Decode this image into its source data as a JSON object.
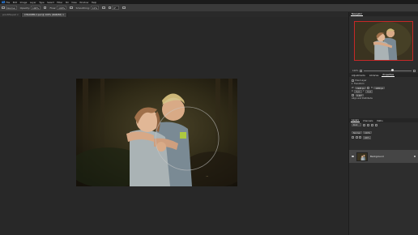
{
  "menubar": {
    "app_logo": "Ps",
    "items": [
      "File",
      "Edit",
      "Image",
      "Layer",
      "Type",
      "Select",
      "Filter",
      "3D",
      "View",
      "Window",
      "Help"
    ]
  },
  "optionsbar": {
    "tool_preset": "Normal",
    "opacity_label": "Opacity:",
    "opacity_value": "100%",
    "flow_label": "Flow:",
    "flow_value": "100%",
    "smoothing_label": "Smoothing:",
    "smoothing_value": "10%",
    "angle_value": "0°"
  },
  "tabs": [
    {
      "label": "proof-file.psd ×",
      "active": false
    },
    {
      "label": "CHILDREN-2.psd @ 100% (RGB/8#) ×",
      "active": true
    }
  ],
  "navigator": {
    "tabs": [
      "Navigator"
    ],
    "zoom": "100%",
    "zoom_fraction": 0.6
  },
  "adjustments": {
    "tabs": [
      "Adjustments",
      "Libraries",
      "Properties"
    ],
    "props": {
      "title": "Pixel Layer",
      "section": "Transform",
      "w_label": "W",
      "w_value": "1920 px",
      "h_label": "H",
      "h_value": "1280 px",
      "x_label": "X",
      "x_value": "0 px",
      "y_label": "Y",
      "y_value": "0 px",
      "angle": "0.00°",
      "align_label": "Align and Distribute"
    }
  },
  "layers": {
    "tabs": [
      "Layers",
      "Channels",
      "Paths"
    ],
    "kind_filter": "Kind",
    "blend_mode": "Normal",
    "opacity": "100%",
    "fill": "100%",
    "layer_name": "Background"
  },
  "icons": {
    "app": "photoshop-logo",
    "eye": "eye-icon",
    "lock": "lock-icon"
  },
  "colors": {
    "accent_blue": "#2d78d1",
    "navigator_frame": "#c62828"
  }
}
